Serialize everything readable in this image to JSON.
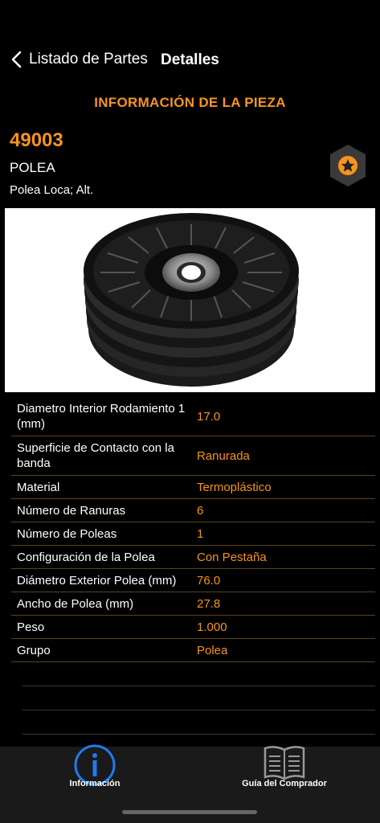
{
  "nav": {
    "back_label": "Listado de Partes",
    "title": "Detalles"
  },
  "section_title": "INFORMACIÓN DE LA PIEZA",
  "part": {
    "number": "49003",
    "name": "POLEA",
    "description": "Polea Loca; Alt."
  },
  "specs": [
    {
      "label": "Diametro Interior Rodamiento 1 (mm)",
      "value": "17.0"
    },
    {
      "label": "Superficie de Contacto con la banda",
      "value": "Ranurada"
    },
    {
      "label": "Material",
      "value": "Termoplástico"
    },
    {
      "label": "Número de Ranuras",
      "value": "6"
    },
    {
      "label": "Número de Poleas",
      "value": "1"
    },
    {
      "label": "Configuración de la Polea",
      "value": "Con Pestaña"
    },
    {
      "label": "Diámetro Exterior Polea (mm)",
      "value": "76.0"
    },
    {
      "label": "Ancho de Polea (mm)",
      "value": "27.8"
    },
    {
      "label": "Peso",
      "value": "1.000"
    },
    {
      "label": "Grupo",
      "value": "Polea"
    }
  ],
  "tabs": [
    {
      "label": "Información",
      "icon": "info-icon"
    },
    {
      "label": "Guía del Comprador",
      "icon": "book-icon"
    }
  ],
  "colors": {
    "accent": "#f7941d",
    "active_tab": "#1e7bf0",
    "background": "#000000"
  }
}
